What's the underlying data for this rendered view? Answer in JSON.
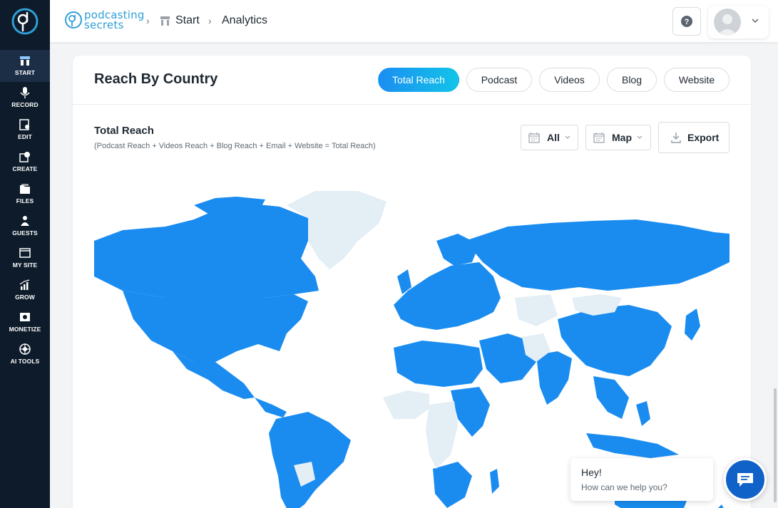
{
  "brand": {
    "line1": "podcasting",
    "line2": "secrets"
  },
  "breadcrumb": {
    "start": "Start",
    "current": "Analytics"
  },
  "sidebar": {
    "items": [
      {
        "label": "START",
        "icon": "start-icon",
        "active": true
      },
      {
        "label": "RECORD",
        "icon": "microphone-icon"
      },
      {
        "label": "EDIT",
        "icon": "edit-icon"
      },
      {
        "label": "CREATE",
        "icon": "create-icon"
      },
      {
        "label": "FILES",
        "icon": "files-icon"
      },
      {
        "label": "GUESTS",
        "icon": "guests-icon"
      },
      {
        "label": "MY SITE",
        "icon": "my-site-icon"
      },
      {
        "label": "GROW",
        "icon": "grow-icon"
      },
      {
        "label": "MONETIZE",
        "icon": "monetize-icon"
      },
      {
        "label": "AI TOOLS",
        "icon": "ai-tools-icon"
      }
    ]
  },
  "card": {
    "title": "Reach By Country",
    "tabs": [
      "Total Reach",
      "Podcast",
      "Videos",
      "Blog",
      "Website"
    ],
    "active_tab": "Total Reach",
    "section_title": "Total Reach",
    "section_desc": "(Podcast Reach + Videos Reach + Blog Reach + Email + Website = Total Reach)",
    "date_filter": "All",
    "view_filter": "Map",
    "export_label": "Export"
  },
  "map": {
    "reach_color": "#1a8cf0",
    "no_reach_color": "#e3eef5"
  },
  "chat": {
    "greeting": "Hey!",
    "prompt": "How can we help you?"
  },
  "colors": {
    "sidebar": "#0d1b2a",
    "accent": "#1a8cf0",
    "brand": "#2f9fd6"
  }
}
